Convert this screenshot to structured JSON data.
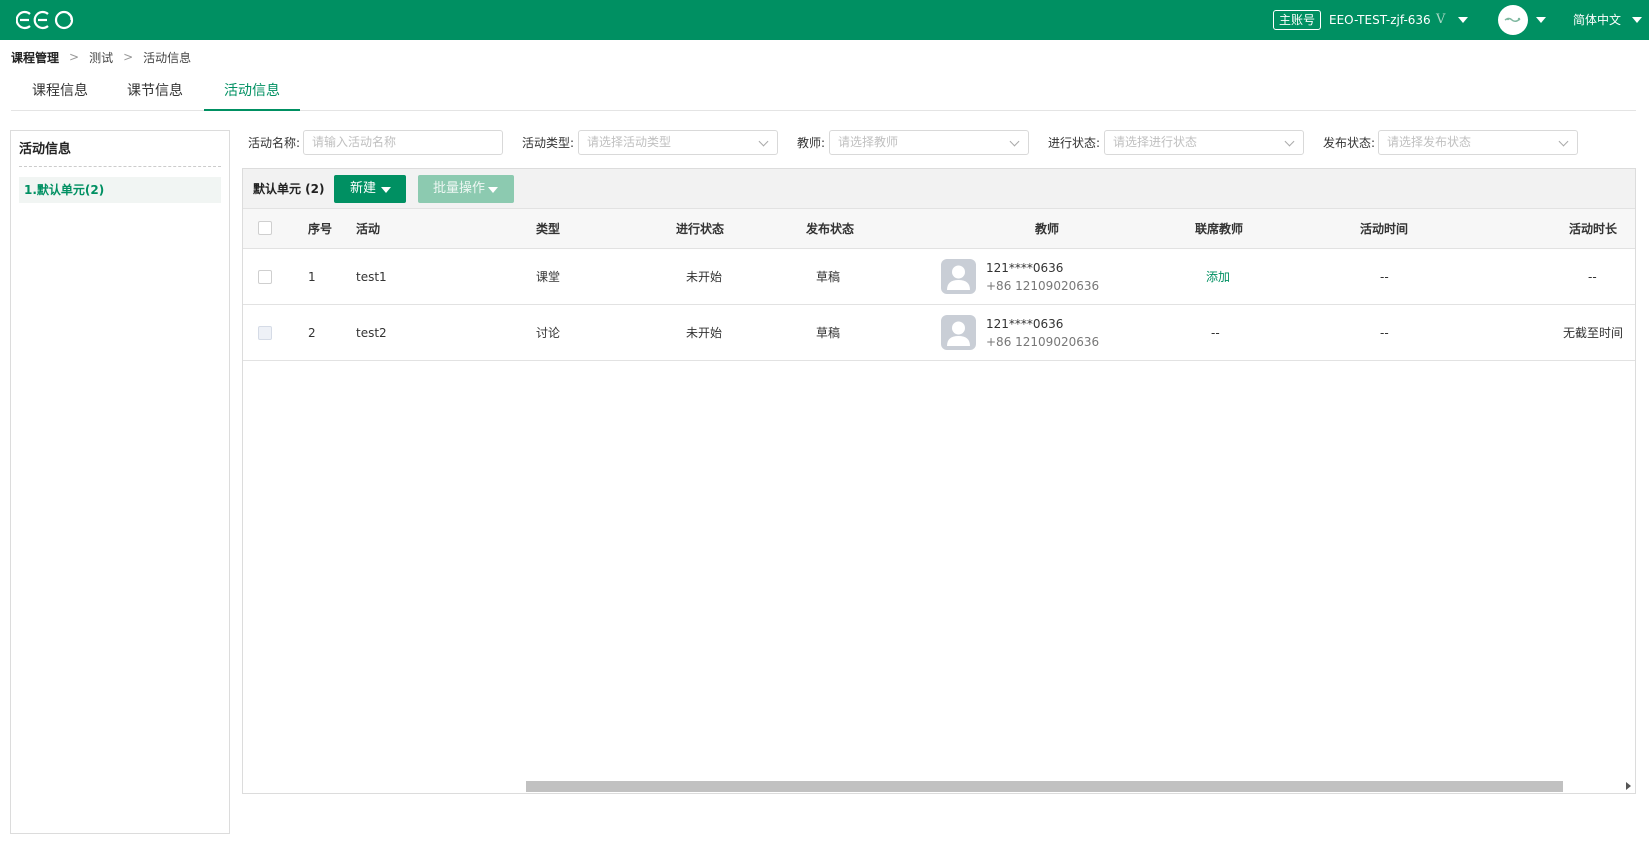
{
  "header": {
    "logo_text": "eeo",
    "role_badge": "主账号",
    "account_name": "EEO-TEST-zjf-636",
    "vip_label": "V",
    "language": "简体中文",
    "brand_color": "#009062"
  },
  "breadcrumb": [
    "课程管理",
    "测试",
    "活动信息"
  ],
  "breadcrumb_sep": ">",
  "tabs": [
    {
      "label": "课程信息",
      "active": false
    },
    {
      "label": "课节信息",
      "active": false
    },
    {
      "label": "活动信息",
      "active": true
    }
  ],
  "left_panel": {
    "title": "活动信息",
    "units": [
      {
        "label": "1.默认单元(2)",
        "selected": true
      }
    ]
  },
  "filters": {
    "activity_name": {
      "label": "活动名称:",
      "placeholder": "请输入活动名称"
    },
    "activity_type": {
      "label": "活动类型:",
      "placeholder": "请选择活动类型"
    },
    "teacher": {
      "label": "教师:",
      "placeholder": "请选择教师"
    },
    "progress_status": {
      "label": "进行状态:",
      "placeholder": "请选择进行状态"
    },
    "publish_status": {
      "label": "发布状态:",
      "placeholder": "请选择发布状态"
    }
  },
  "toolbar": {
    "unit_title": "默认单元 (2)",
    "new_button": "新建",
    "batch_button": "批量操作"
  },
  "table": {
    "columns": [
      "序号",
      "活动",
      "类型",
      "进行状态",
      "发布状态",
      "教师",
      "联席教师",
      "活动时间",
      "活动时长"
    ],
    "rows": [
      {
        "index": "1",
        "activity": "test1",
        "type": "课堂",
        "progress": "未开始",
        "publish": "草稿",
        "teacher_name": "121****0636",
        "teacher_phone": "+86 12109020636",
        "co_teacher": "添加",
        "time": "--",
        "duration": "--"
      },
      {
        "index": "2",
        "activity": "test2",
        "type": "讨论",
        "progress": "未开始",
        "publish": "草稿",
        "teacher_name": "121****0636",
        "teacher_phone": "+86 12109020636",
        "co_teacher": "--",
        "time": "--",
        "duration": "无截至时间"
      }
    ]
  }
}
